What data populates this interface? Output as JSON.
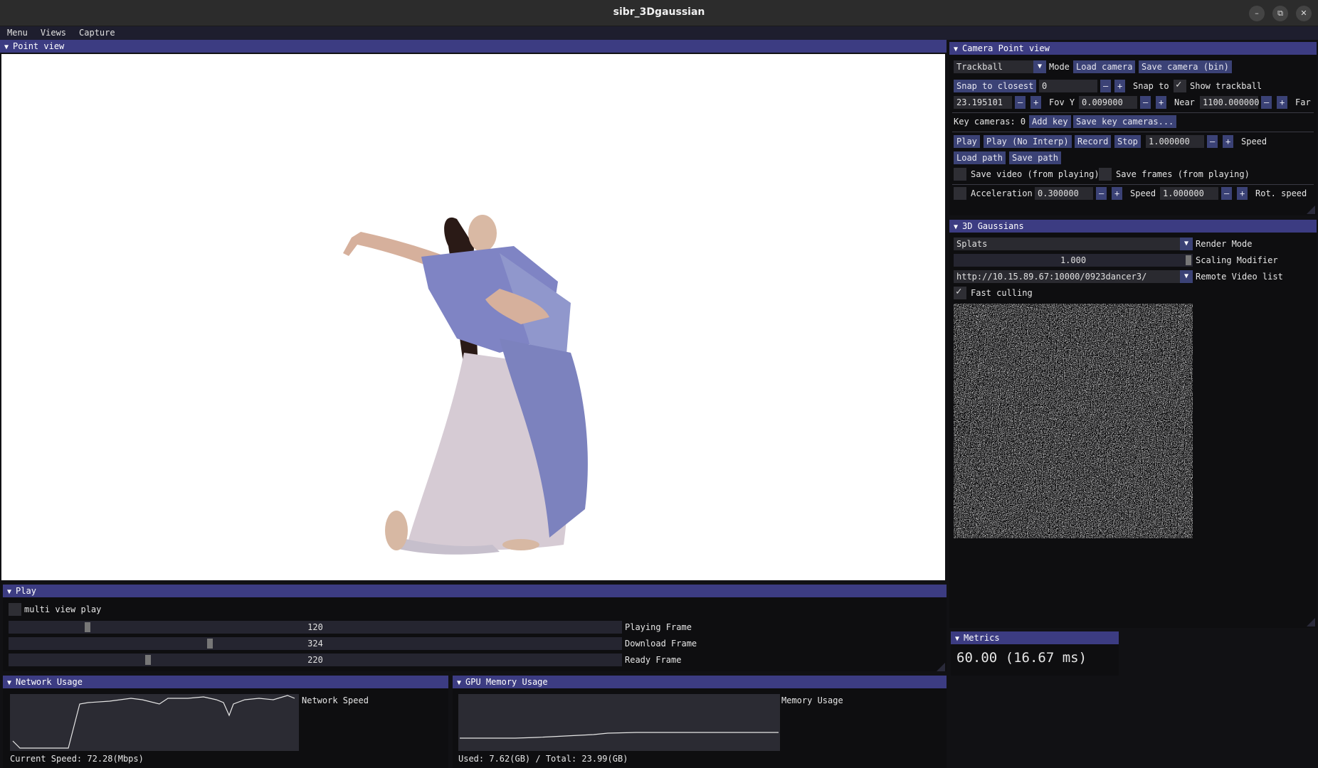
{
  "window": {
    "title": "sibr_3Dgaussian",
    "minimize": "–",
    "restore": "⧉",
    "close": "✕"
  },
  "menubar": [
    "Menu",
    "Views",
    "Capture"
  ],
  "point_view": {
    "title": "Point view"
  },
  "camera_panel": {
    "title": "Camera Point view",
    "mode_value": "Trackball",
    "mode_label": "Mode",
    "load_camera": "Load camera",
    "save_camera": "Save camera (bin)",
    "snap_closest": "Snap to closest",
    "snap_value": "0",
    "snap_to": "Snap to",
    "show_trackball": "Show trackball",
    "fov_value": "23.195101",
    "fov_label": "Fov Y",
    "near_value": "0.009000",
    "near_label": "Near",
    "far_value": "1100.000000",
    "far_label": "Far",
    "key_cameras": "Key cameras: 0",
    "add_key": "Add key",
    "save_key_cameras": "Save key cameras...",
    "play": "Play",
    "play_no_interp": "Play (No Interp)",
    "record": "Record",
    "stop": "Stop",
    "speed_value": "1.000000",
    "speed_label": "Speed",
    "load_path": "Load path",
    "save_path": "Save path",
    "save_video": "Save video (from playing)",
    "save_frames": "Save frames (from playing)",
    "acceleration_label": "Acceleration",
    "acceleration_value": "0.300000",
    "speed2_label": "Speed",
    "speed2_value": "1.000000",
    "rot_speed_label": "Rot. speed",
    "minus": "–",
    "plus": "+"
  },
  "gaussians_panel": {
    "title": "3D Gaussians",
    "render_mode_value": "Splats",
    "render_mode_label": "Render Mode",
    "scaling_value": "1.000",
    "scaling_label": "Scaling Modifier",
    "remote_value": "http://10.15.89.67:10000/0923dancer3/",
    "remote_label": "Remote Video list",
    "fast_culling": "Fast culling"
  },
  "metrics_panel": {
    "title": "Metrics",
    "fps": "60.00 (16.67 ms)"
  },
  "play_panel": {
    "title": "Play",
    "multi_view": "multi view play",
    "sliders": [
      {
        "value": "120",
        "label": "Playing Frame",
        "fraction": 0.125
      },
      {
        "value": "324",
        "label": "Download Frame",
        "fraction": 0.327
      },
      {
        "value": "220",
        "label": "Ready Frame",
        "fraction": 0.225
      }
    ]
  },
  "network_panel": {
    "title": "Network Usage",
    "legend": "Network Speed",
    "current": "Current Speed: 72.28(Mbps)"
  },
  "gpu_panel": {
    "title": "GPU Memory Usage",
    "legend": "Memory Usage",
    "usage": "Used: 7.62(GB) / Total: 23.99(GB)"
  },
  "colors": {
    "header": "#3c3c82",
    "button": "#3b4276",
    "background": "#0e0e10"
  }
}
